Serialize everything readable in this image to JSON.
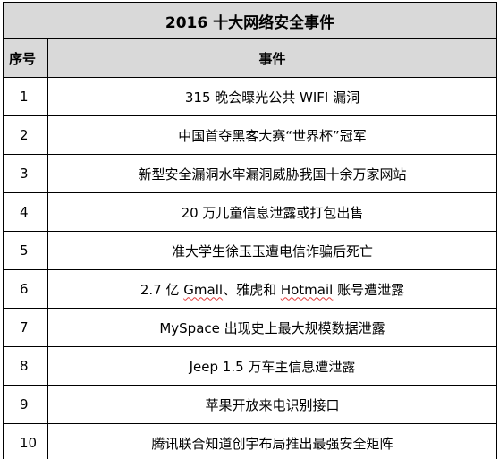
{
  "table": {
    "title": "2016 十大网络安全事件",
    "headers": {
      "seq": "序号",
      "event": "事件"
    },
    "rows": [
      {
        "seq": "1",
        "event": "315 晚会曝光公共 WIFI 漏洞"
      },
      {
        "seq": "2",
        "event": "中国首夺黑客大赛“世界杯”冠军"
      },
      {
        "seq": "3",
        "event": "新型安全漏洞水牢漏洞威胁我国十余万家网站"
      },
      {
        "seq": "4",
        "event": "20 万儿童信息泄露或打包出售"
      },
      {
        "seq": "5",
        "event": "准大学生徐玉玉遭电信诈骗后死亡"
      },
      {
        "seq": "6",
        "event_parts": [
          "2.7 亿 ",
          "Gmall",
          "、雅虎和 ",
          "Hotmail",
          " 账号遭泄露"
        ]
      },
      {
        "seq": "7",
        "event": "MySpace 出现史上最大规模数据泄露"
      },
      {
        "seq": "8",
        "event": "Jeep 1.5 万车主信息遭泄露"
      },
      {
        "seq": "9",
        "event": "苹果开放来电识别接口"
      },
      {
        "seq": "10",
        "event": "腾讯联合知道创宇布局推出最强安全矩阵"
      }
    ]
  },
  "colors": {
    "header_background": "#d9d9d9",
    "border": "#000000",
    "spellcheck_underline": "#e23b3b"
  }
}
